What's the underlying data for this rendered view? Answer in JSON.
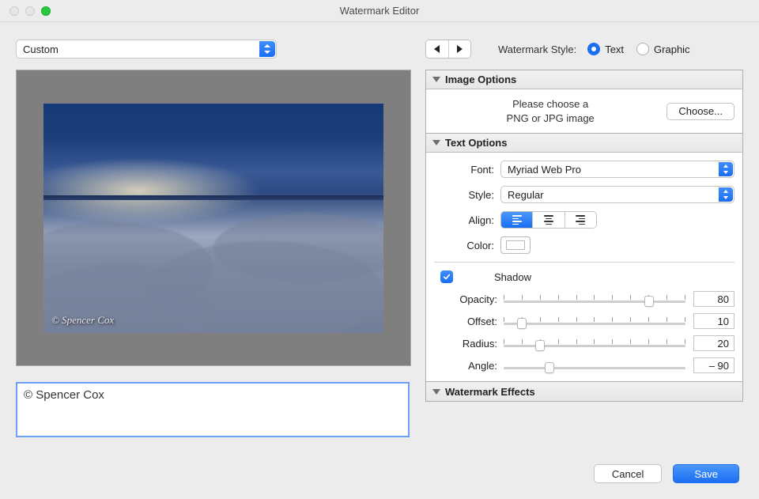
{
  "window": {
    "title": "Watermark Editor"
  },
  "preset": {
    "value": "Custom"
  },
  "nav": {
    "prev_icon": "triangle-left",
    "next_icon": "triangle-right"
  },
  "style_selector": {
    "label": "Watermark Style:",
    "options": {
      "text": "Text",
      "graphic": "Graphic"
    },
    "selected": "text"
  },
  "preview": {
    "watermark_text": "© Spencer Cox"
  },
  "text_input": {
    "value": "© Spencer Cox"
  },
  "panels": {
    "image_options": {
      "title": "Image Options",
      "hint_line1": "Please choose a",
      "hint_line2": "PNG or JPG image",
      "choose_label": "Choose..."
    },
    "text_options": {
      "title": "Text Options",
      "font_label": "Font:",
      "font_value": "Myriad Web Pro",
      "style_label": "Style:",
      "style_value": "Regular",
      "align_label": "Align:",
      "align_selected": "left",
      "color_label": "Color:",
      "color_value": "#FFFFFF",
      "shadow": {
        "checked": true,
        "label": "Shadow",
        "opacity": {
          "label": "Opacity:",
          "value": 80,
          "min": 0,
          "max": 100
        },
        "offset": {
          "label": "Offset:",
          "value": 10,
          "min": 0,
          "max": 100
        },
        "radius": {
          "label": "Radius:",
          "value": 20,
          "min": 0,
          "max": 100
        },
        "angle": {
          "label": "Angle:",
          "value": "– 90",
          "min": -180,
          "max": 180,
          "pct": 25
        }
      }
    },
    "watermark_effects": {
      "title": "Watermark Effects"
    }
  },
  "footer": {
    "cancel": "Cancel",
    "save": "Save"
  }
}
